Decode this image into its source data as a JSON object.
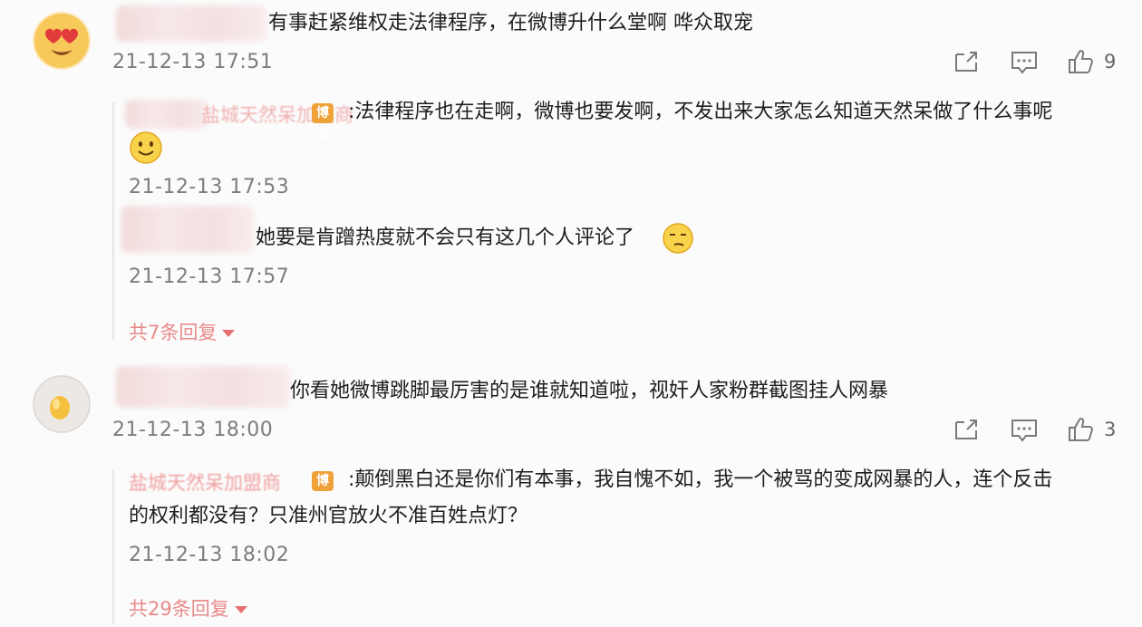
{
  "comments": [
    {
      "text": "有事赶紧维权走法律程序，在微博升什么堂啊 哗众取宠",
      "time": "21-12-13 17:51",
      "likes": "9",
      "replies": [
        {
          "name": "盐城天然呆加盟商",
          "badge": "博主",
          "text_line1": ":法律程序也在走啊，微博也要发啊，不发出来大家怎么知道天然呆做了什么事呢",
          "time": "21-12-13 17:53"
        },
        {
          "text_line1": "她要是肯蹭热度就不会只有这几个人评论了",
          "time": "21-12-13 17:57"
        }
      ],
      "more_replies": "共7条回复"
    },
    {
      "text": "你看她微博跳脚最厉害的是谁就知道啦，视奸人家粉群截图挂人网暴",
      "time": "21-12-13 18:00",
      "likes": "3",
      "replies": [
        {
          "name": "盐城天然呆加盟商",
          "badge": "博主",
          "text_line1": ":颠倒黑白还是你们有本事，我自愧不如，我一个被骂的变成网暴的人，连个反击",
          "text_line2": "的权利都没有？只准州官放火不准百姓点灯？",
          "time": "21-12-13 18:02"
        }
      ],
      "more_replies": "共29条回复"
    }
  ],
  "icons": {
    "share": "share-icon",
    "comment": "comment-icon",
    "like": "thumbs-up-icon"
  },
  "colors": {
    "badge": "#f0a23a",
    "name": "#e98a8a",
    "time": "#7d7d7d"
  }
}
